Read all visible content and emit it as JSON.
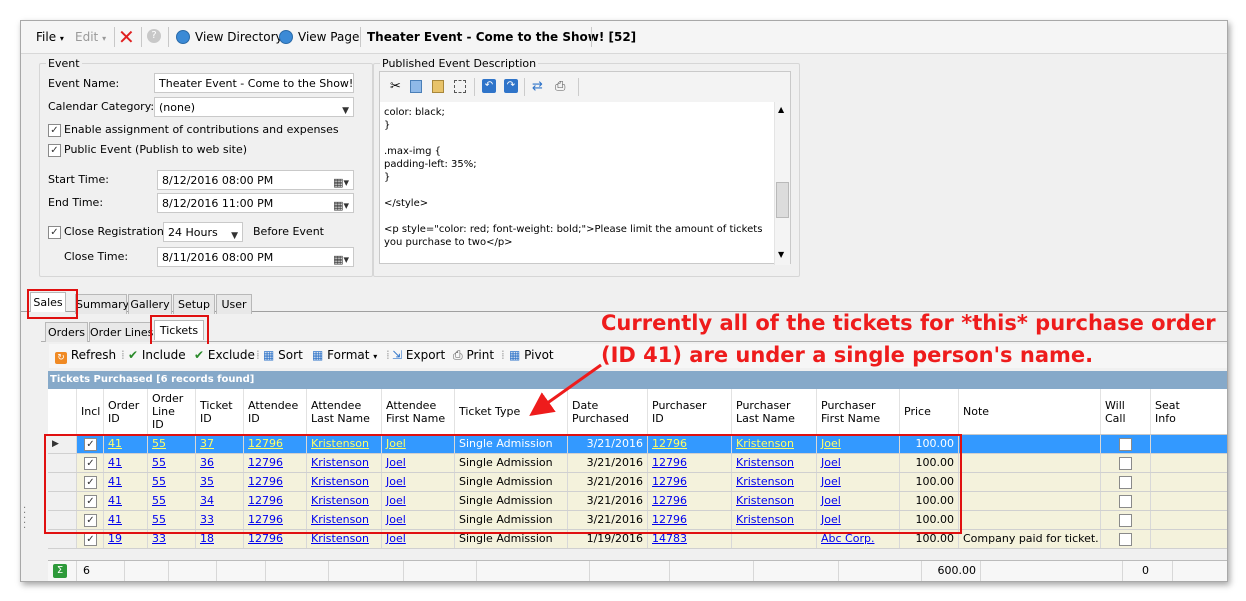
{
  "menubar": {
    "file": "File",
    "edit": "Edit",
    "view_directory": "View Directory",
    "view_page": "View Page",
    "window_title": "Theater Event - Come to the Show! [52]"
  },
  "event": {
    "group_label": "Event",
    "name_label": "Event Name:",
    "name_value": "Theater Event - Come to the Show!",
    "category_label": "Calendar Category:",
    "category_value": "(none)",
    "enable_assignment": "Enable assignment of contributions and expenses",
    "public_event": "Public Event (Publish to web site)",
    "start_label": "Start Time:",
    "start_value": "8/12/2016 08:00 PM",
    "end_label": "End Time:",
    "end_value": "8/12/2016 11:00 PM",
    "close_reg_label": "Close Registration",
    "close_reg_value": "24 Hours",
    "before_event": "Before Event",
    "close_time_label": "Close Time:",
    "close_time_value": "8/11/2016 08:00 PM"
  },
  "description": {
    "group_label": "Published Event Description",
    "text": "color: black;\n}\n\n.max-img {\npadding-left: 35%;\n}\n\n</style>\n\n<p style=\"color: red; font-weight: bold;\">Please limit the amount of tickets\nyou purchase to two</p>"
  },
  "main_tabs": [
    "Sales",
    "Summary",
    "Gallery",
    "Setup",
    "User"
  ],
  "sub_tabs": [
    "Orders",
    "Order Lines",
    "Tickets"
  ],
  "toolbar": {
    "refresh": "Refresh",
    "include": "Include",
    "exclude": "Exclude",
    "sort": "Sort",
    "format": "Format",
    "export": "Export",
    "print": "Print",
    "pivot": "Pivot"
  },
  "grid": {
    "title": "Tickets Purchased [6 records found]",
    "columns": [
      "Incl",
      "Order\nID",
      "Order\nLine\nID",
      "Ticket\nID",
      "Attendee\nID",
      "Attendee\nLast Name",
      "Attendee\nFirst Name",
      "Ticket Type",
      "Date\nPurchased",
      "Purchaser\nID",
      "Purchaser\nLast Name",
      "Purchaser\nFirst Name",
      "Price",
      "Note",
      "Will\nCall",
      "Seat\nInfo"
    ],
    "rows": [
      {
        "order_id": "41",
        "order_line_id": "55",
        "ticket_id": "37",
        "attendee_id": "12796",
        "att_last": "Kristenson",
        "att_first": "Joel",
        "ticket_type": "Single Admission",
        "date": "3/21/2016",
        "purch_id": "12796",
        "purch_last": "Kristenson",
        "purch_first": "Joel",
        "price": "100.00",
        "note": ""
      },
      {
        "order_id": "41",
        "order_line_id": "55",
        "ticket_id": "36",
        "attendee_id": "12796",
        "att_last": "Kristenson",
        "att_first": "Joel",
        "ticket_type": "Single Admission",
        "date": "3/21/2016",
        "purch_id": "12796",
        "purch_last": "Kristenson",
        "purch_first": "Joel",
        "price": "100.00",
        "note": ""
      },
      {
        "order_id": "41",
        "order_line_id": "55",
        "ticket_id": "35",
        "attendee_id": "12796",
        "att_last": "Kristenson",
        "att_first": "Joel",
        "ticket_type": "Single Admission",
        "date": "3/21/2016",
        "purch_id": "12796",
        "purch_last": "Kristenson",
        "purch_first": "Joel",
        "price": "100.00",
        "note": ""
      },
      {
        "order_id": "41",
        "order_line_id": "55",
        "ticket_id": "34",
        "attendee_id": "12796",
        "att_last": "Kristenson",
        "att_first": "Joel",
        "ticket_type": "Single Admission",
        "date": "3/21/2016",
        "purch_id": "12796",
        "purch_last": "Kristenson",
        "purch_first": "Joel",
        "price": "100.00",
        "note": ""
      },
      {
        "order_id": "41",
        "order_line_id": "55",
        "ticket_id": "33",
        "attendee_id": "12796",
        "att_last": "Kristenson",
        "att_first": "Joel",
        "ticket_type": "Single Admission",
        "date": "3/21/2016",
        "purch_id": "12796",
        "purch_last": "Kristenson",
        "purch_first": "Joel",
        "price": "100.00",
        "note": ""
      },
      {
        "order_id": "19",
        "order_line_id": "33",
        "ticket_id": "18",
        "attendee_id": "12796",
        "att_last": "Kristenson",
        "att_first": "Joel",
        "ticket_type": "Single Admission",
        "date": "1/19/2016",
        "purch_id": "14783",
        "purch_last": "",
        "purch_first": "Abc Corp.",
        "price": "100.00",
        "note": "Company paid for ticket."
      }
    ],
    "footer": {
      "count": "6",
      "price_total": "600.00",
      "will_call_total": "0"
    }
  },
  "annotation": {
    "line1": "Currently all of the tickets for *this* purchase order",
    "line2": "(ID 41) are under a single person's name."
  },
  "colors": {
    "annotation": "#ee1c1c",
    "selected_row": "#3399ff",
    "grid_title": "#86a9c9",
    "row_bg": "#f4f2dc"
  }
}
